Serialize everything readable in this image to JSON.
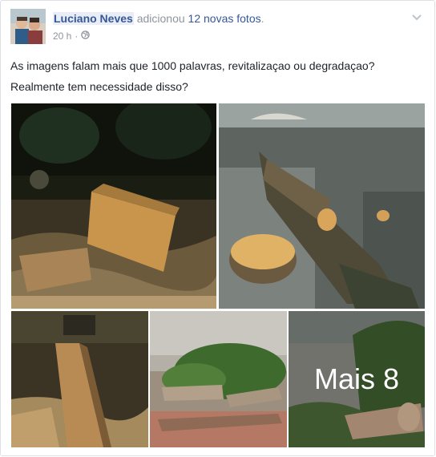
{
  "post": {
    "author": "Luciano Neves",
    "action_text": "adicionou",
    "photos_link": "12 novas fotos",
    "period": ".",
    "time": "20 h",
    "dot": "·",
    "privacy_icon": "globe-icon",
    "options_icon": "chevron-down-icon",
    "text_line1": "As imagens falam mais que 1000 palavras, revitalizaçao ou degradaçao?",
    "text_line2": "Realmente tem necessidade disso?"
  },
  "photos": {
    "more_label": "Mais 8"
  },
  "colors": {
    "link": "#365899",
    "meta": "#90949c",
    "text": "#1d2129",
    "border": "#dddfe2"
  }
}
